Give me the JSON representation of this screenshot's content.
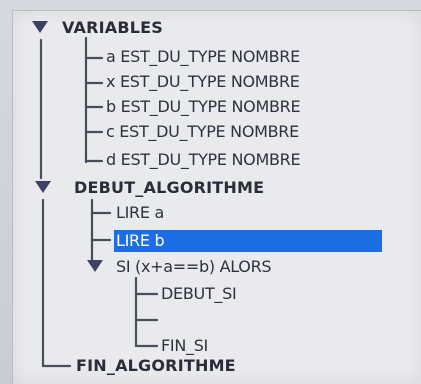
{
  "tree": {
    "variables": {
      "label": "VARIABLES",
      "items": [
        "a EST_DU_TYPE NOMBRE",
        "x EST_DU_TYPE NOMBRE",
        "b EST_DU_TYPE NOMBRE",
        "c EST_DU_TYPE NOMBRE",
        "d EST_DU_TYPE NOMBRE"
      ]
    },
    "algorithm": {
      "label": "DEBUT_ALGORITHME",
      "items": [
        "LIRE a",
        "LIRE b"
      ],
      "selected_item": "LIRE b",
      "condition": {
        "label": "SI (x+a==b) ALORS",
        "start": "DEBUT_SI",
        "empty": "",
        "end": "FIN_SI"
      },
      "end_label": "FIN_ALGORITHME"
    }
  },
  "colors": {
    "selection": "#1e6fe0",
    "toggle": "#3c4266"
  }
}
